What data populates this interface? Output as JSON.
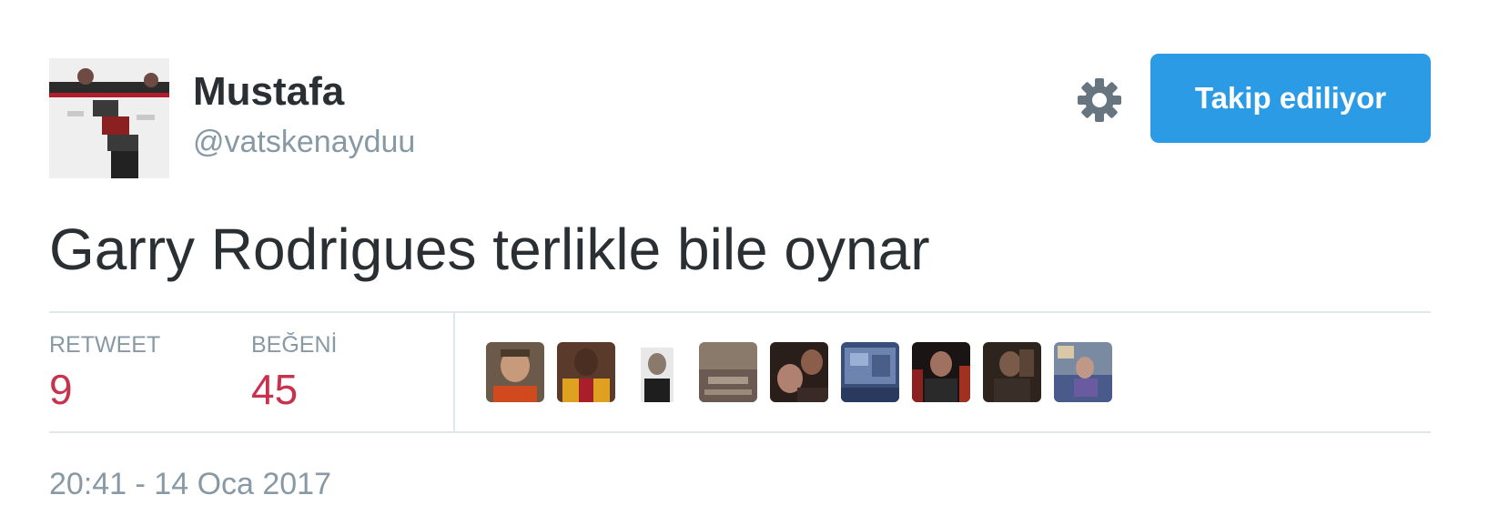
{
  "user": {
    "name": "Mustafa",
    "handle": "@vatskenayduu"
  },
  "header": {
    "settings_icon": "gear-icon",
    "follow_button_label": "Takip ediliyor"
  },
  "tweet": {
    "text": "Garry Rodrigues terlikle bile oynar",
    "timestamp": "20:41 - 14 Oca 2017"
  },
  "stats": {
    "retweet_label": "RETWEET",
    "retweet_count": "9",
    "like_label": "BEĞENİ",
    "like_count": "45"
  },
  "colors": {
    "accent": "#2b9be6",
    "count": "#c8324c",
    "muted": "#8899a6",
    "text": "#292f33",
    "border": "#e1e8ed"
  }
}
